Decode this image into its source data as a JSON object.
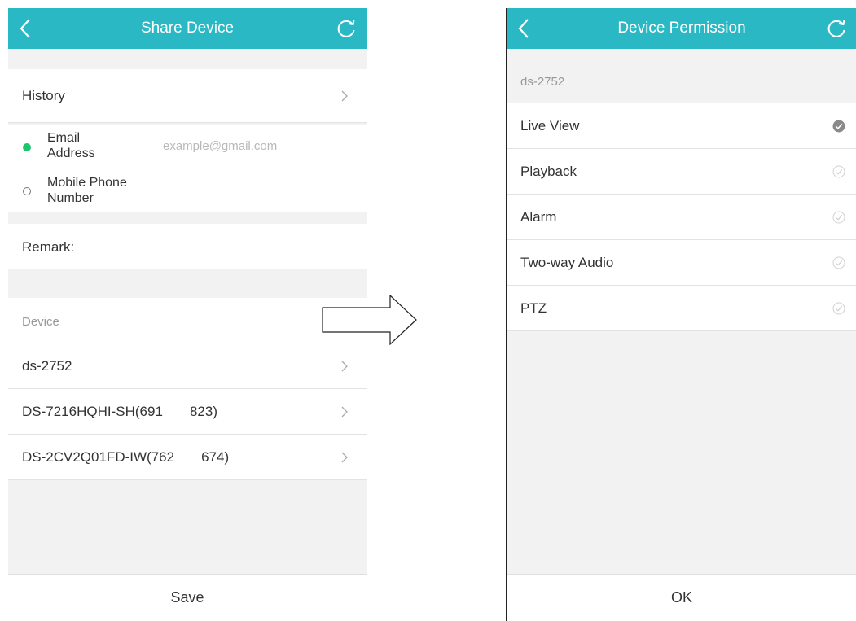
{
  "share": {
    "title": "Share Device",
    "history_label": "History",
    "email_label_1": "Email",
    "email_label_2": "Address",
    "email_placeholder": "example@gmail.com",
    "phone_label_1": "Mobile Phone",
    "phone_label_2": "Number",
    "remark_label": "Remark:",
    "device_section_label": "Device",
    "devices": [
      "ds-2752",
      "DS-7216HQHI-SH(691       823)",
      "DS-2CV2Q01FD-IW(762       674)"
    ],
    "save_label": "Save",
    "icons": [
      "back-icon",
      "refresh-icon",
      "chevron-right-icon",
      "radio-selected-icon",
      "radio-unselected-icon"
    ]
  },
  "permission": {
    "title": "Device Permission",
    "device_name": "ds-2752",
    "items": [
      {
        "label": "Live View",
        "checked": true
      },
      {
        "label": "Playback",
        "checked": false
      },
      {
        "label": "Alarm",
        "checked": false
      },
      {
        "label": "Two-way Audio",
        "checked": false
      },
      {
        "label": "PTZ",
        "checked": false
      }
    ],
    "ok_label": "OK",
    "icons": [
      "back-icon",
      "refresh-icon",
      "check-circle-icon"
    ]
  },
  "colors": {
    "header": "#2ab9c4",
    "radio_active": "#1fc46e",
    "check_active": "#8a8a8a",
    "check_inactive": "#d0d0d0"
  }
}
